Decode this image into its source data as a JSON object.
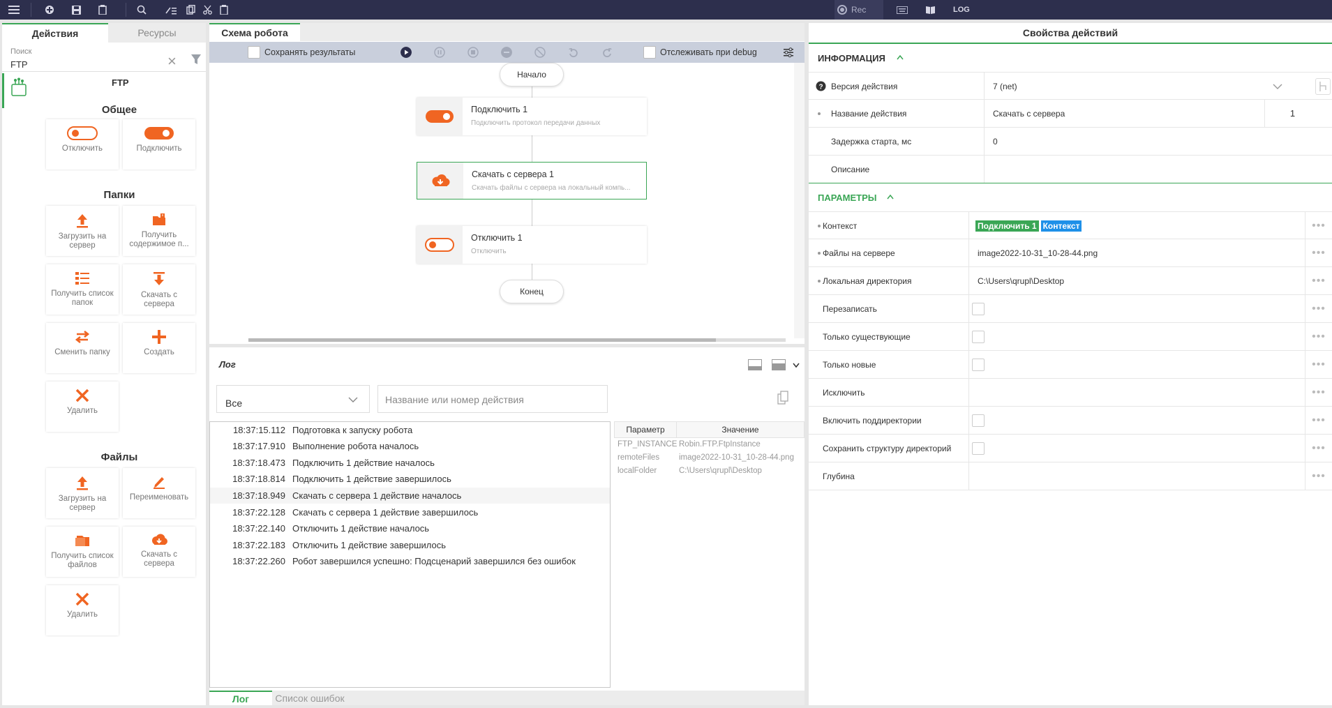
{
  "topbar": {
    "rec_label": "Rec",
    "log_label": "LOG"
  },
  "left": {
    "tabs": [
      "Действия",
      "Ресурсы"
    ],
    "search_label": "Поиск",
    "search_value": "FTP",
    "category_title": "FTP",
    "groups": {
      "general": "Общее",
      "folders": "Папки",
      "files": "Файлы"
    },
    "tiles": {
      "disconnect": "Отключить",
      "connect": "Подключить",
      "upload": "Загрузить на сервер",
      "get_contents": "Получить содержимое п...",
      "list_folders": "Получить список папок",
      "download": "Скачать с сервера",
      "change_folder": "Сменить папку",
      "create": "Создать",
      "delete": "Удалить",
      "file_upload": "Загрузить на сервер",
      "rename": "Переименовать",
      "list_files": "Получить список файлов",
      "file_download": "Скачать с сервера",
      "file_delete": "Удалить"
    }
  },
  "center": {
    "tab": "Схема робота",
    "save_results": "Сохранять результаты",
    "track_debug": "Отслеживать при debug",
    "start": "Начало",
    "end": "Конец",
    "steps": [
      {
        "title": "Подключить  1",
        "subtitle": "Подключить протокол передачи данных"
      },
      {
        "title": "Скачать с сервера  1",
        "subtitle": "Скачать файлы с сервера на локальный компь..."
      },
      {
        "title": "Отключить  1",
        "subtitle": "Отключить"
      }
    ]
  },
  "log": {
    "title": "Лог",
    "filter_value": "Все",
    "search_placeholder": "Название или номер действия",
    "entries": [
      {
        "time": "18:37:15.112",
        "text": "Подготовка к запуску робота"
      },
      {
        "time": "18:37:17.910",
        "text": "Выполнение робота началось"
      },
      {
        "time": "18:37:18.473",
        "text": "Подключить 1 действие началось"
      },
      {
        "time": "18:37:18.814",
        "text": "Подключить 1 действие завершилось"
      },
      {
        "time": "18:37:18.949",
        "text": "Скачать с сервера 1 действие началось"
      },
      {
        "time": "18:37:22.128",
        "text": "Скачать с сервера 1 действие завершилось"
      },
      {
        "time": "18:37:22.140",
        "text": "Отключить 1 действие началось"
      },
      {
        "time": "18:37:22.183",
        "text": "Отключить 1 действие завершилось"
      },
      {
        "time": "18:37:22.260",
        "text": "Робот завершился успешно: Подсценарий завершился без ошибок"
      }
    ],
    "param_header": "Параметр",
    "value_header": "Значение",
    "params": [
      {
        "name": "FTP_INSTANCE",
        "value": "Robin.FTP.FtpInstance"
      },
      {
        "name": "remoteFiles",
        "value": "image2022-10-31_10-28-44.png"
      },
      {
        "name": "localFolder",
        "value": "C:\\Users\\qrupl\\Desktop"
      }
    ],
    "bottom_tabs": [
      "Лог",
      "Список ошибок"
    ]
  },
  "props": {
    "title": "Свойства действий",
    "info_section": "ИНФОРМАЦИЯ",
    "params_section": "ПАРАМЕТРЫ",
    "info_rows": [
      {
        "name": "Версия действия",
        "value": "7 (net)"
      },
      {
        "name": "Название действия",
        "value": "Скачать с сервера",
        "extra": "1"
      },
      {
        "name": "Задержка старта, мс",
        "value": "0"
      },
      {
        "name": "Описание",
        "value": ""
      }
    ],
    "param_rows": [
      {
        "name": "Контекст",
        "tag1": "Подключить 1",
        "tag2": "Контекст"
      },
      {
        "name": "Файлы на сервере",
        "value": "image2022-10-31_10-28-44.png"
      },
      {
        "name": "Локальная директория",
        "value": "C:\\Users\\qrupl\\Desktop"
      },
      {
        "name": "Перезаписать"
      },
      {
        "name": "Только существующие"
      },
      {
        "name": "Только новые"
      },
      {
        "name": "Исключить",
        "value": ""
      },
      {
        "name": "Включить поддиректории"
      },
      {
        "name": "Сохранить структуру директорий"
      },
      {
        "name": "Глубина",
        "value": ""
      }
    ],
    "colors": {
      "accent": "#3aa655",
      "orange": "#f06522",
      "tag_blue": "#1e90e8"
    }
  }
}
